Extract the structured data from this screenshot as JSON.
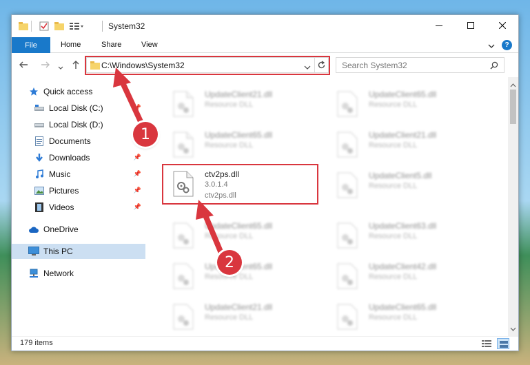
{
  "window": {
    "title": "System32",
    "controls": [
      "minimize-icon",
      "maximize-icon",
      "close-icon"
    ]
  },
  "ribbon": {
    "file_label": "File",
    "tabs": [
      "Home",
      "Share",
      "View"
    ],
    "help_label": "?"
  },
  "address": {
    "path": "C:\\Windows\\System32",
    "search_placeholder": "Search System32"
  },
  "nav": {
    "items": [
      {
        "label": "Quick access",
        "icon": "star-icon"
      },
      {
        "label": "Local Disk (C:)",
        "icon": "drive-icon"
      },
      {
        "label": "Local Disk (D:)",
        "icon": "drive-icon"
      },
      {
        "label": "Documents",
        "icon": "documents-icon"
      },
      {
        "label": "Downloads",
        "icon": "download-icon"
      },
      {
        "label": "Music",
        "icon": "music-icon"
      },
      {
        "label": "Pictures",
        "icon": "pictures-icon"
      },
      {
        "label": "Videos",
        "icon": "videos-icon"
      },
      {
        "label": "OneDrive",
        "icon": "cloud-icon"
      },
      {
        "label": "This PC",
        "icon": "computer-icon"
      },
      {
        "label": "Network",
        "icon": "network-icon"
      }
    ]
  },
  "files": {
    "left": [
      {
        "name": "UpdateClient21.dll",
        "type": "Resource DLL"
      },
      {
        "name": "UpdateClient65.dll",
        "type": "Resource DLL"
      },
      {
        "name": "ctv2ps.dll",
        "type": "3.0.1.4",
        "sub": "ctv2ps.dll"
      },
      {
        "name": "UpdateClient65.dll",
        "type": "Resource DLL"
      },
      {
        "name": "UpdateClient65.dll",
        "type": "Resource DLL"
      },
      {
        "name": "UpdateClient21.dll",
        "type": "Resource DLL"
      }
    ],
    "right": [
      {
        "name": "UpdateClient65.dll",
        "type": "Resource DLL"
      },
      {
        "name": "UpdateClient21.dll",
        "type": "Resource DLL"
      },
      {
        "name": "UpdateClient5.dll",
        "type": "Resource DLL"
      },
      {
        "name": "UpdateClient63.dll",
        "type": "Resource DLL"
      },
      {
        "name": "UpdateClient42.dll",
        "type": "Resource DLL"
      },
      {
        "name": "UpdateClient65.dll",
        "type": "Resource DLL"
      }
    ]
  },
  "status": {
    "item_count": "179 items"
  },
  "annotations": {
    "marker1": "1",
    "marker2": "2",
    "color": "#d9363e"
  }
}
